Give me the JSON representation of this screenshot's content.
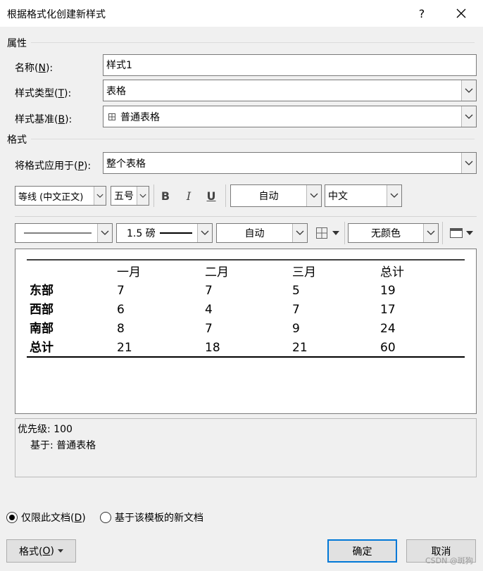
{
  "window": {
    "title": "根据格式化创建新样式",
    "help_glyph": "?"
  },
  "properties": {
    "section_label": "属性",
    "name": {
      "label": "名称(",
      "key": "N",
      "suffix": "):",
      "value": "样式1"
    },
    "style_type": {
      "label": "样式类型(",
      "key": "T",
      "suffix": "):",
      "value": "表格"
    },
    "style_based_on": {
      "label": "样式基准(",
      "key": "B",
      "suffix": "):",
      "value": "普通表格",
      "icon": "table-grid-icon"
    }
  },
  "format": {
    "section_label": "格式",
    "apply_to": {
      "label": "将格式应用于(",
      "key": "P",
      "suffix": "):",
      "value": "整个表格"
    },
    "font": "等线 (中文正文)",
    "size": "五号",
    "bold": "B",
    "italic": "I",
    "underline": "U",
    "font_color": "自动",
    "script": "中文",
    "border_width": "1.5 磅",
    "border_color": "自动",
    "shading": "无颜色"
  },
  "preview": {
    "header": [
      "",
      "一月",
      "二月",
      "三月",
      "总计"
    ],
    "rows": [
      [
        "东部",
        "7",
        "7",
        "5",
        "19"
      ],
      [
        "西部",
        "6",
        "4",
        "7",
        "17"
      ],
      [
        "南部",
        "8",
        "7",
        "9",
        "24"
      ],
      [
        "总计",
        "21",
        "18",
        "21",
        "60"
      ]
    ]
  },
  "description": {
    "priority": "优先级: 100",
    "based_on": "基于: 普通表格"
  },
  "options": {
    "this_doc_only": {
      "label": "仅限此文档(",
      "key": "D",
      "suffix": ")",
      "checked": true
    },
    "new_from_template": {
      "label": "基于该模板的新文档",
      "checked": false
    }
  },
  "buttons": {
    "format": {
      "label": "格式(",
      "key": "O",
      "suffix": ")"
    },
    "ok": "确定",
    "cancel": "取消"
  },
  "watermark": "CSDN @斑狗"
}
